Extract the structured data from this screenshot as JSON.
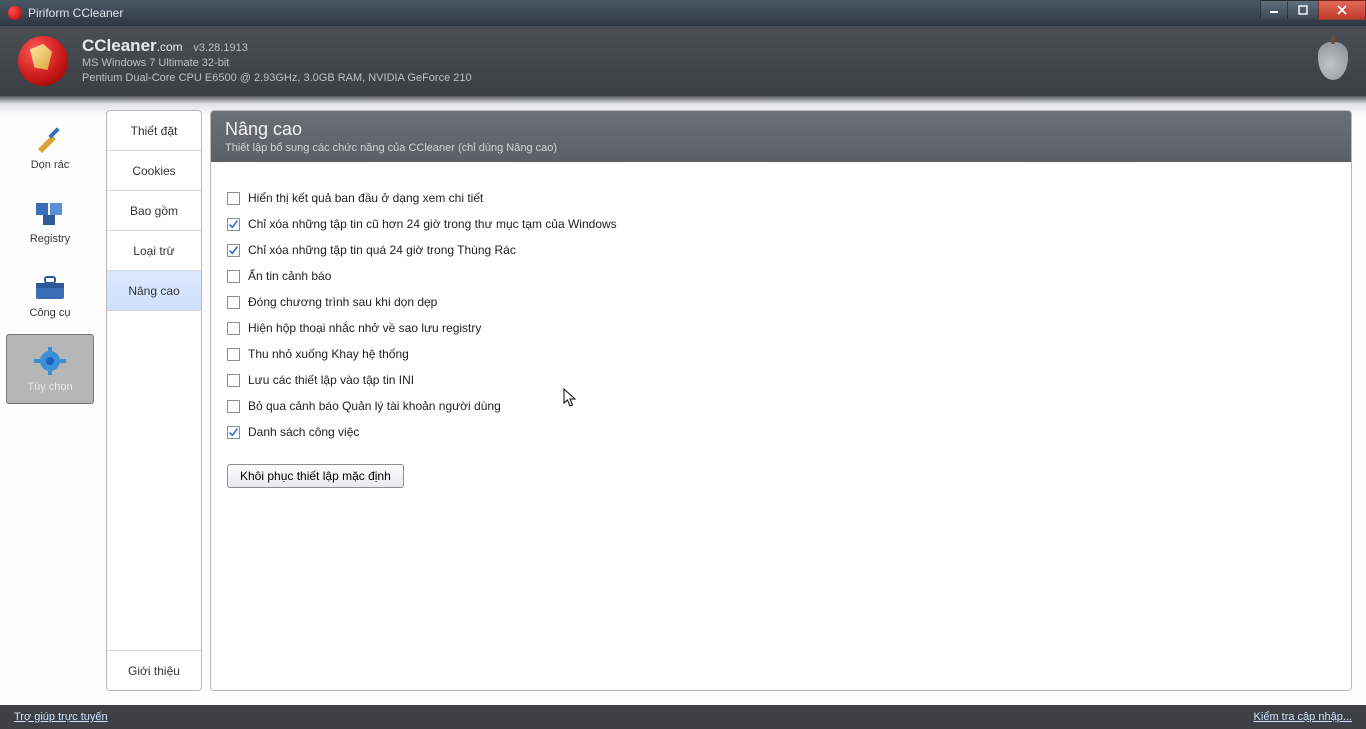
{
  "window": {
    "title": "Piriform CCleaner"
  },
  "header": {
    "brand": "CCleaner",
    "brand_suffix": ".com",
    "version": "v3.28.1913",
    "sys_line1": "MS Windows 7 Ultimate 32-bit",
    "sys_line2": "Pentium Dual-Core CPU E6500 @ 2.93GHz, 3.0GB RAM, NVIDIA GeForce 210"
  },
  "nav": {
    "items": [
      {
        "label": "Dọn rác"
      },
      {
        "label": "Registry"
      },
      {
        "label": "Công cụ"
      },
      {
        "label": "Tùy chọn"
      }
    ]
  },
  "subtabs": {
    "items": [
      {
        "label": "Thiết đặt"
      },
      {
        "label": "Cookies"
      },
      {
        "label": "Bao gồm"
      },
      {
        "label": "Loại trừ"
      },
      {
        "label": "Nâng cao"
      }
    ],
    "about_label": "Giới thiệu"
  },
  "panel": {
    "title": "Nâng cao",
    "subtitle": "Thiết lập bổ sung các chức năng của CCleaner (chỉ dùng Nâng cao)",
    "options": [
      {
        "label": "Hiển thị kết quả ban đầu ở dạng xem chi tiết",
        "checked": false
      },
      {
        "label": "Chỉ xóa những tập tin cũ hơn 24 giờ trong thư mục tạm của Windows",
        "checked": true
      },
      {
        "label": "Chỉ xóa những tập tin quá 24 giờ trong Thùng Rác",
        "checked": true
      },
      {
        "label": "Ẩn tin cảnh báo",
        "checked": false
      },
      {
        "label": "Đóng chương trình sau khi dọn dẹp",
        "checked": false
      },
      {
        "label": "Hiện hộp thoại nhắc nhở về sao lưu registry",
        "checked": false
      },
      {
        "label": "Thu nhỏ xuống Khay hệ thống",
        "checked": false
      },
      {
        "label": "Lưu các thiết lập vào tập tin INI",
        "checked": false
      },
      {
        "label": "Bỏ qua cảnh báo Quản lý tài khoản người dùng",
        "checked": false
      },
      {
        "label": "Danh sách công việc",
        "checked": true
      }
    ],
    "restore_button": "Khôi phục thiết lập mặc định"
  },
  "footer": {
    "help_link": "Trợ giúp trực tuyến",
    "update_link": "Kiểm tra cập nhập..."
  }
}
